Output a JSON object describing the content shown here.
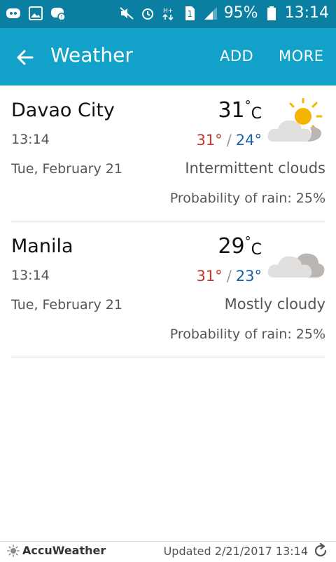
{
  "status_bar": {
    "battery": "95%",
    "time": "13:14",
    "icons_left": [
      "discord-icon",
      "image-icon",
      "discord-notification-icon"
    ],
    "icons_right": [
      "mute-icon",
      "alarm-icon",
      "data-icon",
      "sim-icon",
      "signal-icon",
      "battery-icon"
    ]
  },
  "app_bar": {
    "title": "Weather",
    "add_label": "ADD",
    "more_label": "MORE",
    "background": "#12a2c9"
  },
  "cities": [
    {
      "name": "Davao City",
      "time": "13:14",
      "date": "Tue, February 21",
      "temp": "31",
      "deg_symbol": "°",
      "unit": "C",
      "high": "31°",
      "sep": "/",
      "low": "24°",
      "condition": "Intermittent clouds",
      "rain": "Probability of rain: 25%",
      "icon": "partly-cloudy-icon"
    },
    {
      "name": "Manila",
      "time": "13:14",
      "date": "Tue, February 21",
      "temp": "29",
      "deg_symbol": "°",
      "unit": "C",
      "high": "31°",
      "sep": "/",
      "low": "23°",
      "condition": "Mostly cloudy",
      "rain": "Probability of rain: 25%",
      "icon": "cloudy-icon"
    }
  ],
  "footer": {
    "brand": "AccuWeather",
    "updated": "Updated 2/21/2017 13:14"
  }
}
